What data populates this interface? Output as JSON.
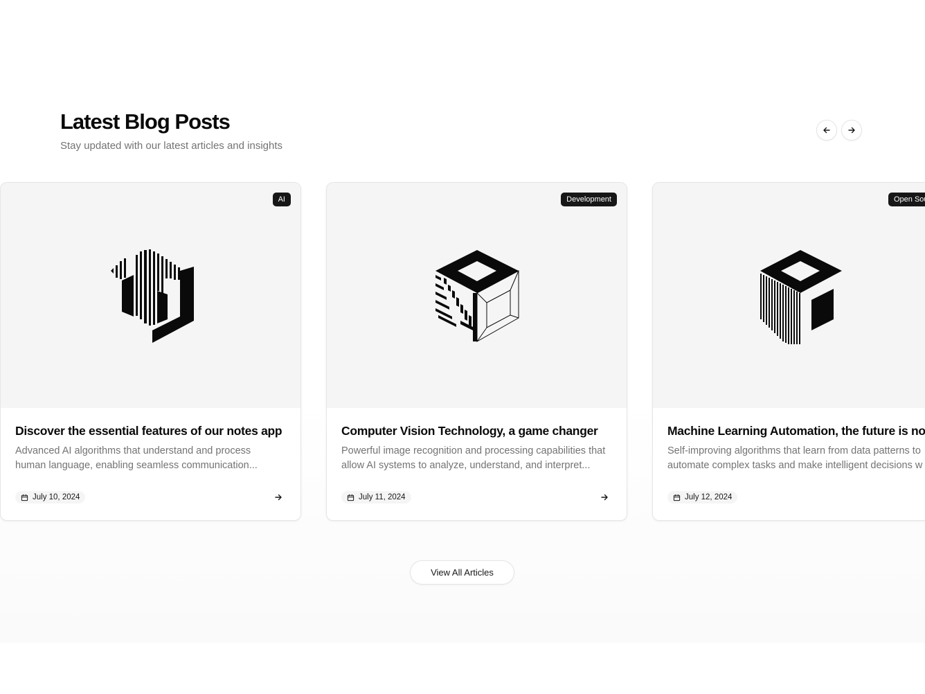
{
  "header": {
    "title": "Latest Blog Posts",
    "subtitle": "Stay updated with our latest articles and insights"
  },
  "nav": {
    "prev_icon": "arrow-left-icon",
    "next_icon": "arrow-right-icon"
  },
  "posts": [
    {
      "tag": "AI",
      "title": "Discover the essential features of our notes app",
      "description_lines": [
        "Advanced AI algorithms that understand and process",
        "human language, enabling seamless communication..."
      ],
      "date": "July 10, 2024",
      "logo_icon": "striped-hexagon-logo-icon"
    },
    {
      "tag": "Development",
      "title": "Computer Vision Technology, a game changer",
      "description_lines": [
        "Powerful image recognition and processing capabilities that",
        "allow AI systems to analyze, understand, and interpret..."
      ],
      "date": "July 11, 2024",
      "logo_icon": "wireframe-cube-logo-icon"
    },
    {
      "tag": "Open Sou",
      "title": "Machine Learning Automation, the future is now",
      "description_lines": [
        "Self-improving algorithms that learn from data patterns to",
        "automate complex tasks and make intelligent decisions w"
      ],
      "date": "July 12, 2024",
      "logo_icon": "solid-cube-logo-icon"
    }
  ],
  "icons": {
    "calendar": "calendar-icon",
    "read_more": "arrow-right-icon"
  },
  "cta": {
    "label": "View All Articles"
  },
  "colors": {
    "text_primary": "#0a0a0a",
    "text_muted": "#737373",
    "tag_bg": "#171717",
    "media_bg": "#f5f5f5",
    "border": "#e5e5e5"
  }
}
